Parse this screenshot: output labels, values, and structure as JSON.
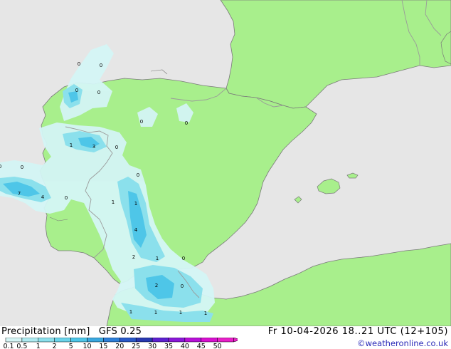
{
  "header": {
    "product_label": "Precipitation [mm]",
    "model_label": "GFS 0.25",
    "datetime_label": "Fr 10-04-2026 18..21 UTC (12+105)"
  },
  "credit": "©weatheronline.co.uk",
  "colors": {
    "sea": "#e6e6e6",
    "land": "#a8ef8c",
    "border": "#9a9a9a",
    "coast": "#7a7a7a"
  },
  "legend": {
    "tick_labels": [
      "0.1",
      "0.5",
      "1",
      "2",
      "5",
      "10",
      "15",
      "20",
      "25",
      "30",
      "35",
      "40",
      "45",
      "50"
    ],
    "swatch_colors": [
      "#d4f5f5",
      "#aeeaf0",
      "#8be0ec",
      "#6ad4ea",
      "#4ec6e8",
      "#3aa8e0",
      "#2d7fd8",
      "#2858c8",
      "#2838b0",
      "#5d20d0",
      "#8a18d8",
      "#b810d8",
      "#d810d0",
      "#e820c8"
    ]
  },
  "map_labels": [
    {
      "text": "0",
      "cls": "val"
    },
    {
      "text": "0",
      "cls": "val"
    },
    {
      "text": "0",
      "cls": "val"
    },
    {
      "text": "0",
      "cls": "val"
    },
    {
      "text": "0",
      "cls": "val"
    },
    {
      "text": "0",
      "cls": "val"
    },
    {
      "text": "1",
      "cls": "val"
    },
    {
      "text": "3",
      "cls": "val"
    },
    {
      "text": "0",
      "cls": "val"
    },
    {
      "text": "0",
      "cls": "val"
    },
    {
      "text": "0",
      "cls": "val"
    },
    {
      "text": "7",
      "cls": "val"
    },
    {
      "text": "4",
      "cls": "val"
    },
    {
      "text": "0",
      "cls": "val"
    },
    {
      "text": "1",
      "cls": "val"
    },
    {
      "text": "1",
      "cls": "val"
    },
    {
      "text": "4",
      "cls": "val"
    },
    {
      "text": "2",
      "cls": "val"
    },
    {
      "text": "1",
      "cls": "val"
    },
    {
      "text": "0",
      "cls": "val"
    },
    {
      "text": "2",
      "cls": "val"
    },
    {
      "text": "0",
      "cls": "val"
    },
    {
      "text": "1",
      "cls": "val"
    },
    {
      "text": "1",
      "cls": "val"
    },
    {
      "text": "1",
      "cls": "val"
    },
    {
      "text": "1",
      "cls": "val"
    },
    {
      "text": "0",
      "cls": "val"
    }
  ]
}
